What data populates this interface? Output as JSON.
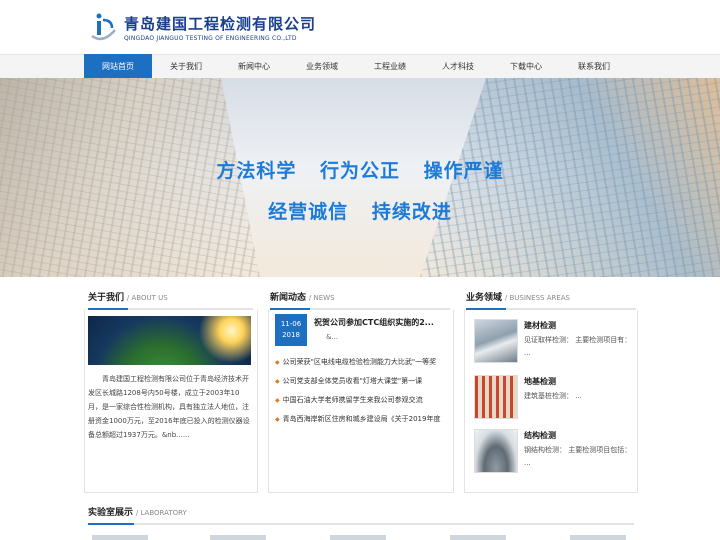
{
  "header": {
    "company_cn": "青岛建国工程检测有限公司",
    "company_en": "QINGDAO JIANGUO TESTING OF ENGINEERING CO.,LTD"
  },
  "nav": [
    {
      "label": "网站首页",
      "active": true
    },
    {
      "label": "关于我们",
      "active": false
    },
    {
      "label": "新闻中心",
      "active": false
    },
    {
      "label": "业务领域",
      "active": false
    },
    {
      "label": "工程业绩",
      "active": false
    },
    {
      "label": "人才科技",
      "active": false
    },
    {
      "label": "下载中心",
      "active": false
    },
    {
      "label": "联系我们",
      "active": false
    }
  ],
  "banner": {
    "line1": [
      "方法科学",
      "行为公正",
      "操作严谨"
    ],
    "line2": [
      "经营诚信",
      "持续改进"
    ]
  },
  "about": {
    "title_cn": "关于我们",
    "title_en": "ABOUT US",
    "text": "青岛建国工程检测有限公司位于青岛经济技术开发区长城路1208号内50号楼，成立于2003年10月，是一家综合性检测机构，具有独立法人地位，注册资金1000万元，至2016年底已投入的检测仪器设备总额超过1937万元。&nb......"
  },
  "news": {
    "title_cn": "新闻动态",
    "title_en": "NEWS",
    "featured": {
      "month_day": "11-06",
      "year": "2018",
      "headline": "祝贺公司参加CTC组织实施的2...",
      "summary": "&..."
    },
    "items": [
      "公司荣获\"区电线电缆检验检测能力大比武\"一等奖",
      "公司党支部全体党员收看\"灯塔大课堂\"第一课",
      "中国石油大学老师携留学生来我公司参观交流",
      "青岛西海岸新区住房和城乡建设局《关于2019年度"
    ]
  },
  "business": {
    "title_cn": "业务领域",
    "title_en": "BUSINESS AREAS",
    "items": [
      {
        "name": "建材检测",
        "desc": "见证取样检测：  主要检测项目有：  ..."
      },
      {
        "name": "地基检测",
        "desc": "建筑基桩检测：  ..."
      },
      {
        "name": "结构检测",
        "desc": "钢结构检测：  主要检测项目包括：  ..."
      }
    ]
  },
  "lab": {
    "title_cn": "实验室展示",
    "title_en": "LABORATORY"
  },
  "colors": {
    "primary": "#1d6fc2",
    "accent": "#e07a20"
  }
}
